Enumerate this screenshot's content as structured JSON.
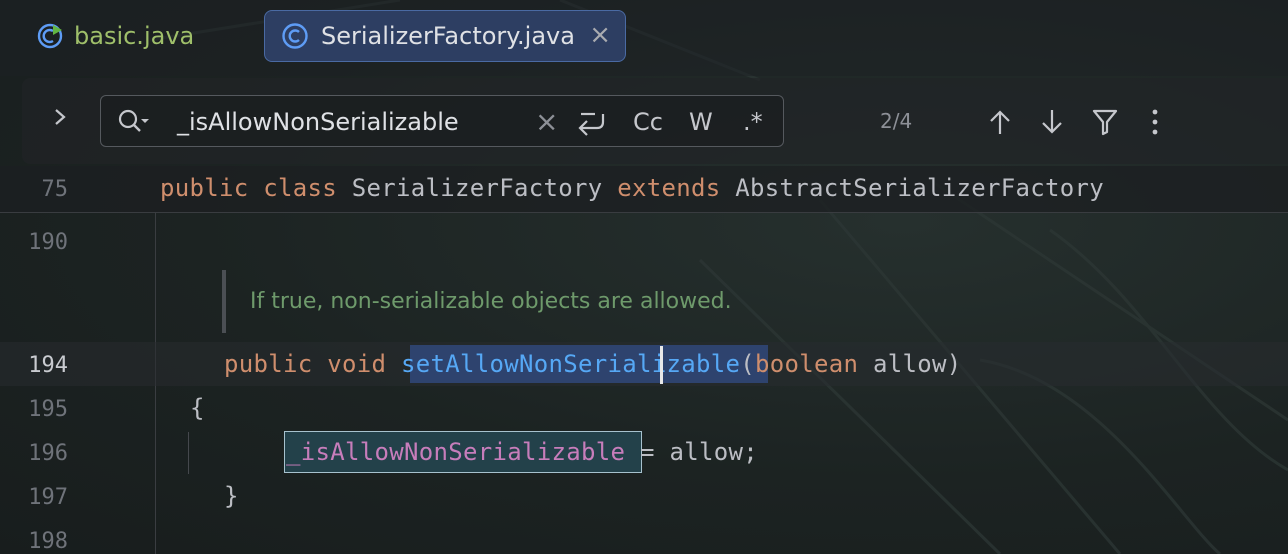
{
  "tabs": [
    {
      "label": "basic.java",
      "active": false,
      "icon": "run-config-icon"
    },
    {
      "label": "SerializerFactory.java",
      "active": true,
      "icon": "class-icon"
    }
  ],
  "search": {
    "value": "_isAllowNonSerializable",
    "options": {
      "newline": "↵",
      "match_case": "Cc",
      "words": "W",
      "regex": ".*"
    },
    "clear": "×",
    "match_count": "2/4"
  },
  "editor": {
    "sticky_line": {
      "number": "75",
      "tokens": [
        "public",
        "class",
        "SerializerFactory",
        "extends",
        "AbstractSerializerFactory"
      ]
    },
    "line_numbers": [
      "190",
      "194",
      "195",
      "196",
      "197",
      "198"
    ],
    "doc_comment": "If true, non-serializable objects are allowed.",
    "line194": {
      "kw1": "public",
      "kw2": "void",
      "method": "setAllowNonSerializable",
      "open": "(",
      "type": "boolean",
      "param": "allow",
      "close": ")"
    },
    "line195": "{",
    "line196": {
      "field": "_isAllowNonSerializable",
      "rest": " = allow;"
    },
    "line197": "}"
  },
  "colors": {
    "keyword": "#cf8e6d",
    "method": "#56a8f5",
    "field": "#c77dbb",
    "comment": "#6e9a6b",
    "active_tab": "#2d3e62"
  }
}
